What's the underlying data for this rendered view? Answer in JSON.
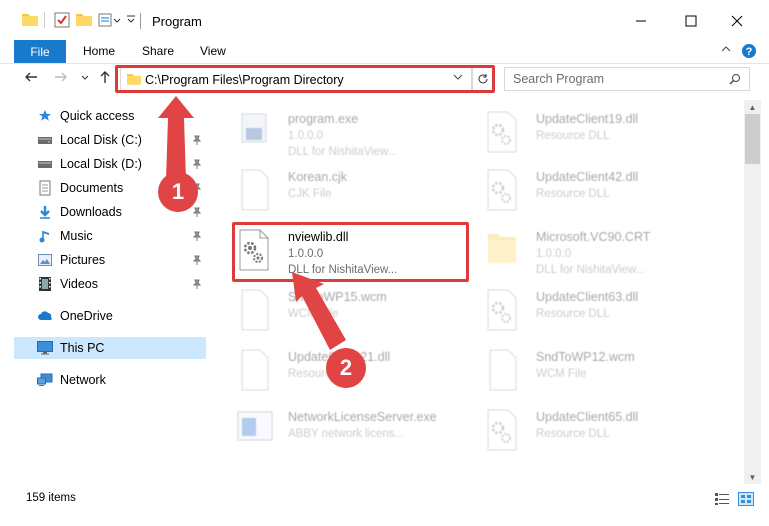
{
  "window": {
    "title": "Program",
    "minimize": "—",
    "maximize": "☐",
    "close": "✕"
  },
  "ribbon": {
    "tabs": [
      "File",
      "Home",
      "Share",
      "View"
    ]
  },
  "address": {
    "path": "C:\\Program Files\\Program Directory",
    "search_placeholder": "Search Program"
  },
  "sidebar": {
    "items": [
      {
        "label": "Quick access",
        "icon": "star-icon",
        "pinned": false
      },
      {
        "label": "Local Disk (C:)",
        "icon": "drive-icon",
        "pinned": true
      },
      {
        "label": "Local Disk (D:)",
        "icon": "drive-icon",
        "pinned": true
      },
      {
        "label": "Documents",
        "icon": "documents-icon",
        "pinned": true
      },
      {
        "label": "Downloads",
        "icon": "download-icon",
        "pinned": true
      },
      {
        "label": "Music",
        "icon": "music-icon",
        "pinned": true
      },
      {
        "label": "Pictures",
        "icon": "pictures-icon",
        "pinned": true
      },
      {
        "label": "Videos",
        "icon": "videos-icon",
        "pinned": true
      },
      {
        "label": "OneDrive",
        "icon": "cloud-icon",
        "pinned": false
      },
      {
        "label": "This PC",
        "icon": "computer-icon",
        "pinned": false,
        "selected": true
      },
      {
        "label": "Network",
        "icon": "network-icon",
        "pinned": false
      }
    ]
  },
  "files": {
    "left": [
      {
        "name": "program.exe",
        "line1": "1.0.0.0",
        "line2": "DLL for NishitaView..."
      },
      {
        "name": "Korean.cjk",
        "line1": "CJK File",
        "line2": ""
      },
      {
        "name": "nviewlib.dll",
        "line1": "1.0.0.0",
        "line2": "DLL for NishitaView..."
      },
      {
        "name": "SndToWP15.wcm",
        "line1": "WCM File",
        "line2": ""
      },
      {
        "name": "UpdateClient21.dll",
        "line1": "Resource DLL",
        "line2": ""
      },
      {
        "name": "NetworkLicenseServer.exe",
        "line1": "ABBY network licens...",
        "line2": ""
      }
    ],
    "right": [
      {
        "name": "UpdateClient19.dll",
        "line1": "Resource DLL",
        "line2": ""
      },
      {
        "name": "UpdateClient42.dll",
        "line1": "Resource DLL",
        "line2": ""
      },
      {
        "name": "Microsoft.VC90.CRT",
        "line1": "1.0.0.0",
        "line2": "DLL for NishitaView..."
      },
      {
        "name": "UpdateClient63.dll",
        "line1": "Resource DLL",
        "line2": ""
      },
      {
        "name": "SndToWP12.wcm",
        "line1": "WCM File",
        "line2": ""
      },
      {
        "name": "UpdateClient65.dll",
        "line1": "Resource DLL",
        "line2": ""
      }
    ]
  },
  "status": {
    "item_count": "159 items"
  },
  "annotations": {
    "step1": "1",
    "step2": "2"
  },
  "colors": {
    "accent": "#1979ca",
    "highlight": "#dd3b3b",
    "selected_bg": "#cce8ff"
  }
}
